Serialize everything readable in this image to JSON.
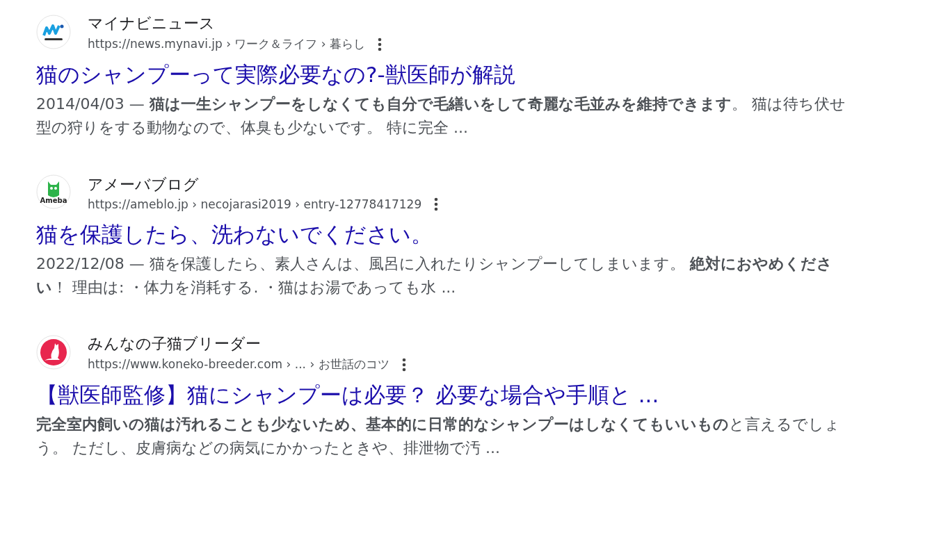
{
  "results": [
    {
      "kind": "mynavi",
      "site": "マイナビニュース",
      "url": "https://news.mynavi.jp › ワーク＆ライフ › 暮らし",
      "title": "猫のシャンプーって実際必要なの?-獣医師が解説",
      "date": "2014/04/03 —",
      "snippet": "**猫は一生シャンプーをしなくても自分で毛繕いをして奇麗な毛並みを維持できます**。 猫は待ち伏せ型の狩りをする動物なので、体臭も少ないです。 特に完全 ..."
    },
    {
      "kind": "ameba",
      "logo_text": "Ameba",
      "site": "アメーバブログ",
      "url": "https://ameblo.jp › necojarasi2019 › entry-12778417129",
      "title": "猫を保護したら、洗わないでください。",
      "date": "2022/12/08 —",
      "snippet": "猫を保護したら、素人さんは、風呂に入れたりシャンプーしてしまいます。 **絶対におやめください**！ 理由は: ・体力を消耗する. ・猫はお湯であっても水 ..."
    },
    {
      "kind": "cat",
      "site": "みんなの子猫ブリーダー",
      "url": "https://www.koneko-breeder.com › ... › お世話のコツ",
      "title": "【獣医師監修】猫にシャンプーは必要？ 必要な場合や手順と ...",
      "snippet": "**完全室内飼いの猫は汚れることも少ないため、基本的に日常的なシャンプーはしなくてもいいもの**と言えるでしょう。 ただし、皮膚病などの病気にかかったときや、排泄物で汚 ..."
    }
  ]
}
